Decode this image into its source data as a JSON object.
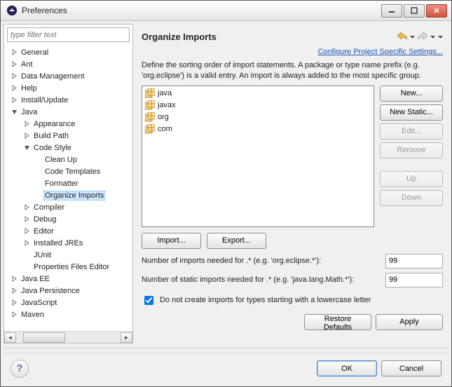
{
  "window": {
    "title": "Preferences"
  },
  "filter": {
    "placeholder": "type filter text"
  },
  "tree": {
    "general": "General",
    "ant": "Ant",
    "datamgmt": "Data Management",
    "help": "Help",
    "install": "Install/Update",
    "java": "Java",
    "appearance": "Appearance",
    "buildpath": "Build Path",
    "codestyle": "Code Style",
    "cleanup": "Clean Up",
    "codetemplates": "Code Templates",
    "formatter": "Formatter",
    "organizeimports": "Organize Imports",
    "compiler": "Compiler",
    "debug": "Debug",
    "editor": "Editor",
    "installedjres": "Installed JREs",
    "junit": "JUnit",
    "propfiles": "Properties Files Editor",
    "javaee": "Java EE",
    "javapersist": "Java Persistence",
    "javascript": "JavaScript",
    "maven": "Maven"
  },
  "page": {
    "title": "Organize Imports",
    "link": "Configure Project Specific Settings...",
    "desc": "Define the sorting order of import statements. A package or type name prefix (e.g. 'org.eclipse') is a valid entry. An import is always added to the most specific group.",
    "entries": [
      "java",
      "javax",
      "org",
      "com"
    ],
    "buttons": {
      "new": "New...",
      "newstatic": "New Static...",
      "edit": "Edit...",
      "remove": "Remove",
      "up": "Up",
      "down": "Down",
      "import": "Import...",
      "export": "Export..."
    },
    "numimports_label": "Number of imports needed for .* (e.g. 'org.eclipse.*'):",
    "numimports_value": "99",
    "numstatic_label": "Number of static imports needed for .* (e.g. 'java.lang.Math.*'):",
    "numstatic_value": "99",
    "lowercase_label": "Do not create imports for types starting with a lowercase letter",
    "lowercase_checked": true,
    "restore": "Restore Defaults",
    "apply": "Apply"
  },
  "buttons": {
    "ok": "OK",
    "cancel": "Cancel"
  }
}
